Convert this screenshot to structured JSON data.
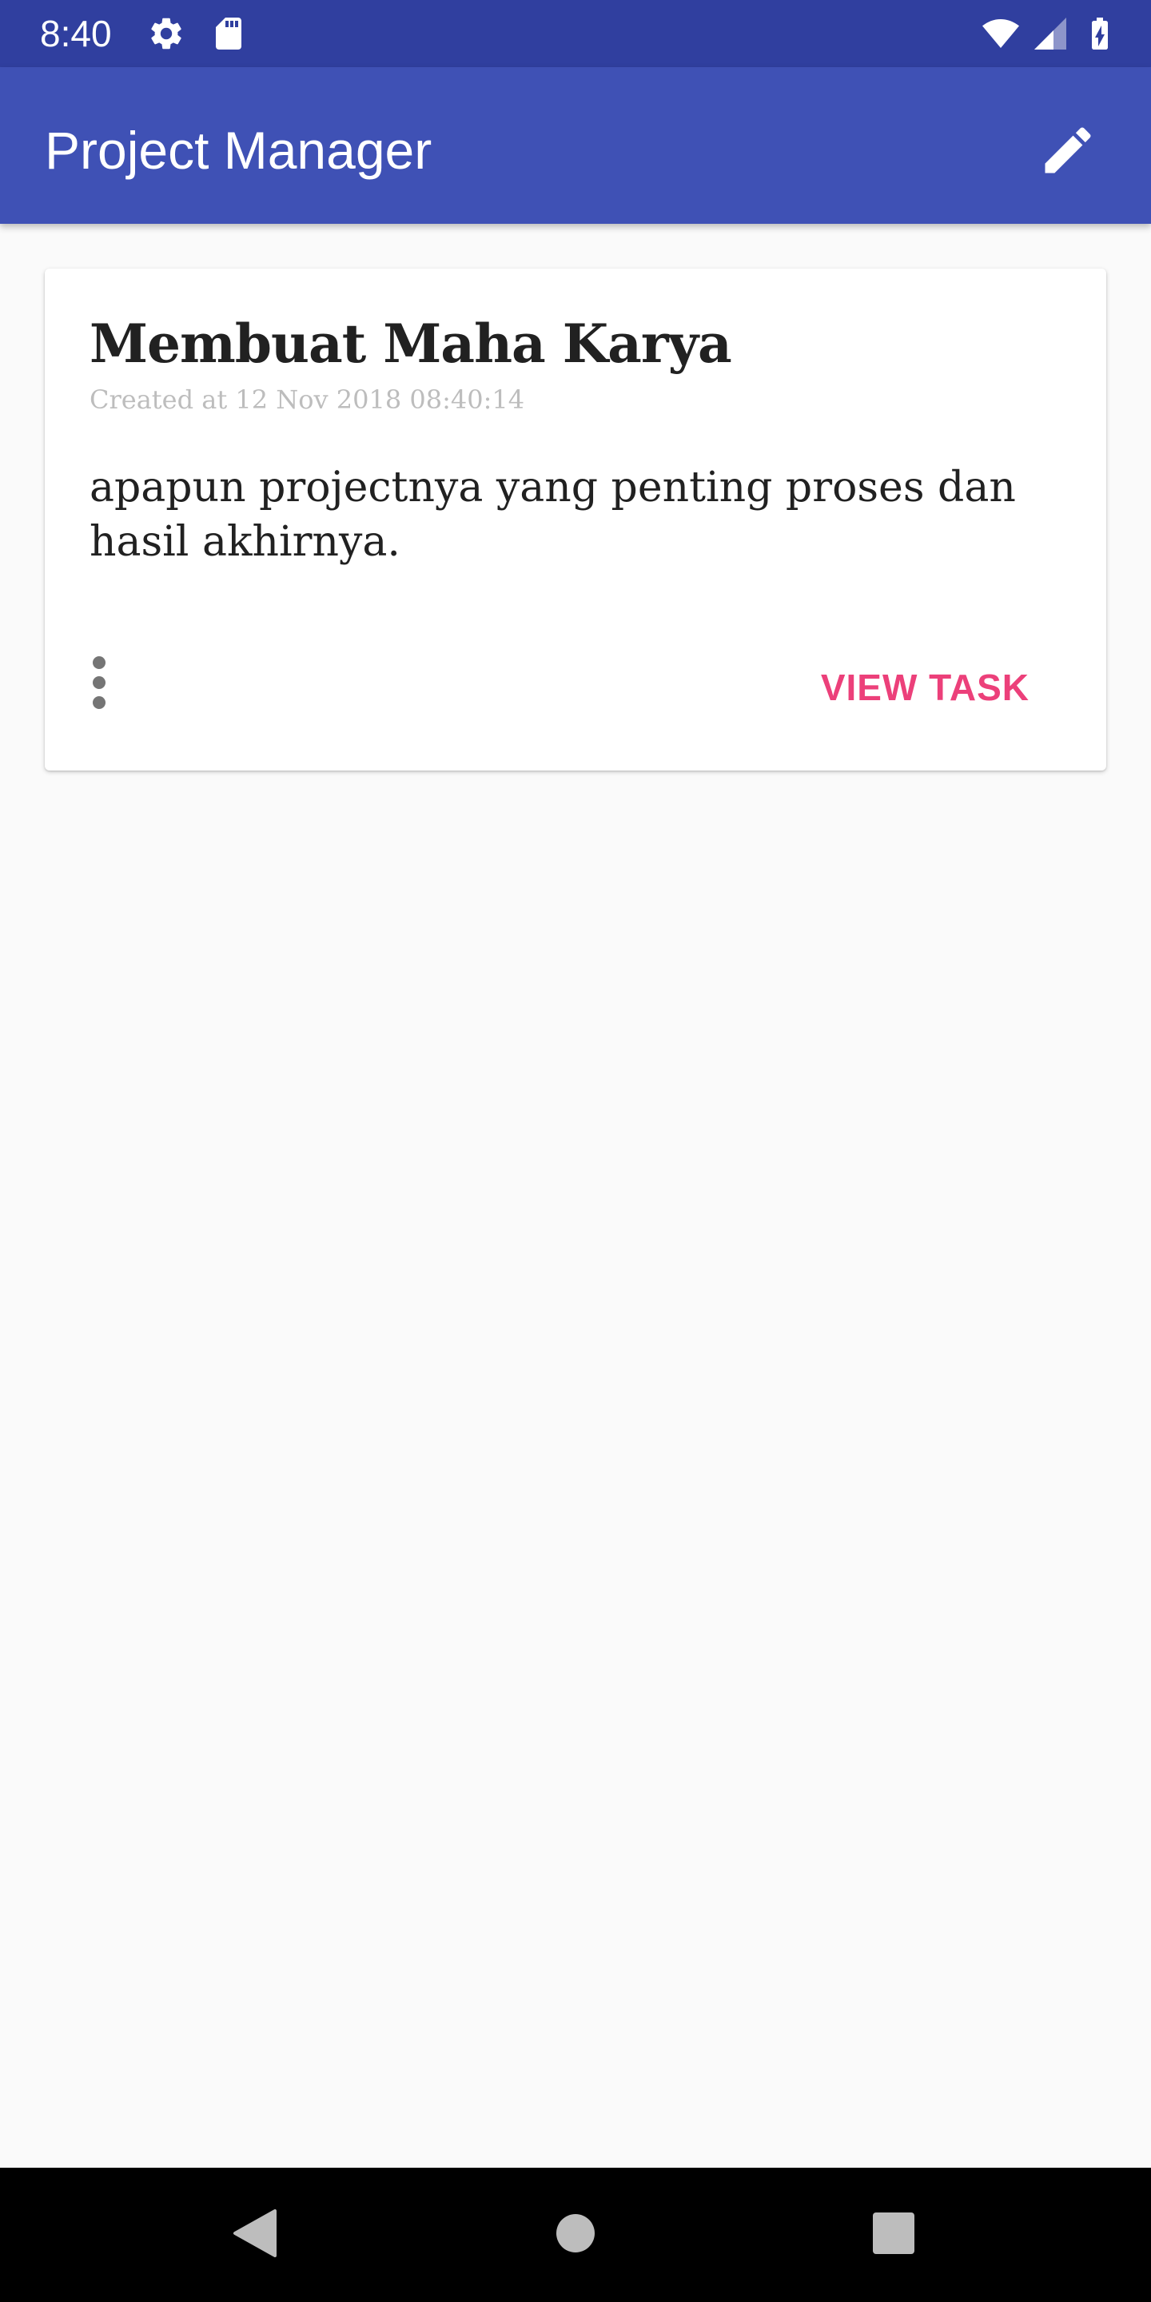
{
  "status_bar": {
    "time": "8:40",
    "icons": [
      "gear-icon",
      "sd-card-icon",
      "wifi-icon",
      "signal-icon",
      "battery-charging-icon"
    ]
  },
  "app_bar": {
    "title": "Project Manager",
    "action_icon": "edit-icon"
  },
  "project_card": {
    "title": "Membuat Maha Karya",
    "created": "Created at 12 Nov 2018 08:40:14",
    "description": "apapun projectnya yang penting proses dan hasil akhirnya.",
    "more_icon": "more-vert-icon",
    "view_task_label": "VIEW TASK"
  },
  "nav_bar": {
    "buttons": [
      "back-icon",
      "home-icon",
      "recents-icon"
    ]
  },
  "colors": {
    "status_bar": "#303f9f",
    "app_bar": "#3f51b5",
    "accent": "#ec407a",
    "background": "#fafafa"
  }
}
